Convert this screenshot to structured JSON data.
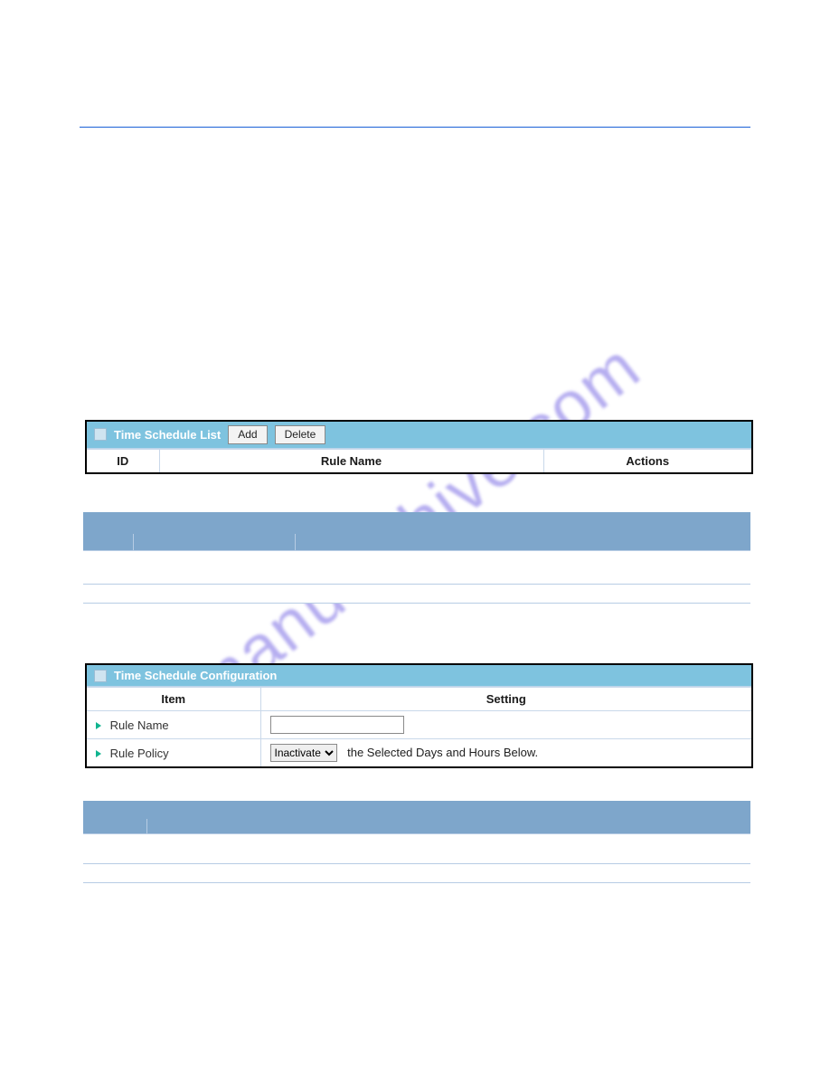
{
  "watermark": "manualshive.com",
  "panel1": {
    "title": "Time Schedule List",
    "add_label": "Add",
    "delete_label": "Delete",
    "columns": {
      "id": "ID",
      "rule_name": "Rule Name",
      "actions": "Actions"
    }
  },
  "panel2": {
    "title": "Time Schedule Configuration",
    "columns": {
      "item": "Item",
      "setting": "Setting"
    },
    "rows": {
      "rule_name": {
        "label": "Rule Name",
        "value": ""
      },
      "rule_policy": {
        "label": "Rule Policy",
        "select_value": "Inactivate",
        "options": [
          "Inactivate"
        ],
        "suffix": "the Selected Days and Hours Below."
      }
    }
  }
}
